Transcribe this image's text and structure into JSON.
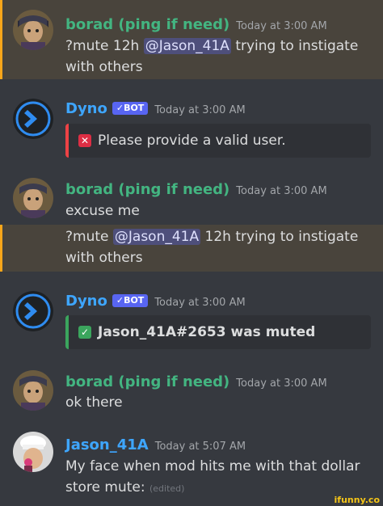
{
  "messages": [
    {
      "author": "borad (ping if need)",
      "timestamp": "Today at 3:00 AM",
      "line1": {
        "pre": "?mute 12h ",
        "mention": "@Jason_41A",
        "post": " trying to instigate"
      },
      "line2": "with others"
    },
    {
      "author": "Dyno",
      "bot_badge": "✓BOT",
      "timestamp": "Today at 3:00 AM",
      "embed": {
        "icon": "✕",
        "text": "Please provide a valid user."
      }
    },
    {
      "author": "borad (ping if need)",
      "timestamp": "Today at 3:00 AM",
      "text": "excuse me",
      "line1": {
        "pre": "?mute ",
        "mention": "@Jason_41A",
        "post": " 12h trying to instigate"
      },
      "line2": "with others"
    },
    {
      "author": "Dyno",
      "bot_badge": "✓BOT",
      "timestamp": "Today at 3:00 AM",
      "embed": {
        "icon": "✓",
        "text": "Jason_41A#2653 was muted"
      }
    },
    {
      "author": "borad (ping if need)",
      "timestamp": "Today at 3:00 AM",
      "text": "ok there"
    },
    {
      "author": "Jason_41A",
      "timestamp": "Today at 5:07 AM",
      "line1": "My face when mod hits me with that dollar",
      "line2": "store mute:",
      "edited": "(edited)"
    }
  ],
  "watermark": "ifunny.co",
  "colors": {
    "background": "#36393f",
    "highlight": "#49443c",
    "highlight_bar": "#faa61a",
    "green_name": "#43b581",
    "blue_name": "#3ea6ff",
    "error_bar": "#ed4245",
    "success_bar": "#3ba55d"
  }
}
